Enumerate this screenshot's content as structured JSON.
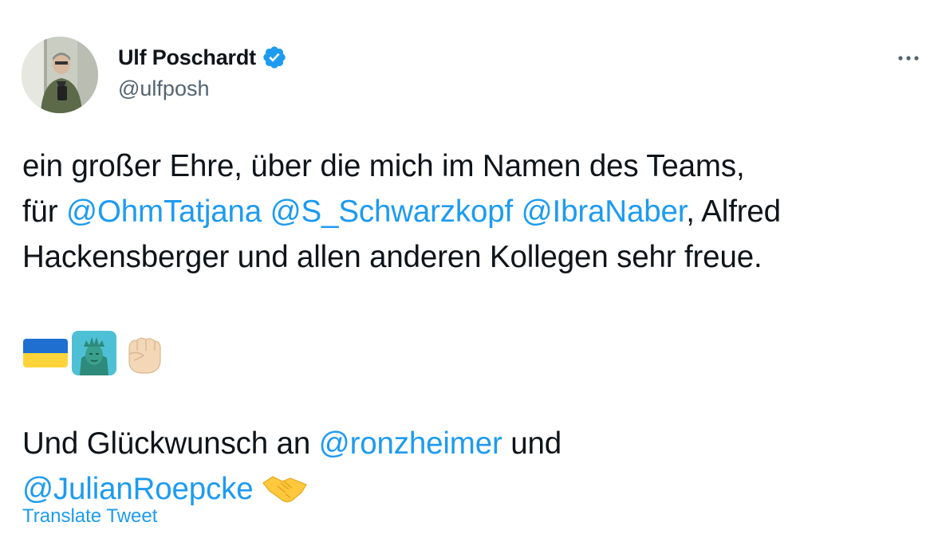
{
  "author": {
    "display_name": "Ulf Poschardt",
    "handle": "@ulfposh",
    "verified": true
  },
  "icons": {
    "avatar": "avatar-photo",
    "verified": "verified-badge-icon",
    "more": "more-options-icon",
    "emoji_1": "ukraine-flag-emoji",
    "emoji_2": "statue-of-liberty-emoji",
    "emoji_3": "raised-fist-emoji",
    "emoji_4": "handshake-emoji"
  },
  "tweet": {
    "line1": "ein großer Ehre, über die mich im Namen des Teams,",
    "line2_prefix": "für ",
    "mention_1": "@OhmTatjana",
    "mention_2": "@S_Schwarzkopf",
    "mention_3": "@IbraNaber",
    "line2_suffix": ", Alfred",
    "line3": "Hackensberger und allen anderen Kollegen sehr freue.",
    "line4_prefix": "Und Glückwunsch an ",
    "mention_4": "@ronzheimer",
    "line4_suffix": " und",
    "mention_5": "@JulianRoepcke"
  },
  "translate_label": "Translate Tweet",
  "colors": {
    "link": "#1d9bf0",
    "text": "#0f1419",
    "secondary": "#536471"
  }
}
